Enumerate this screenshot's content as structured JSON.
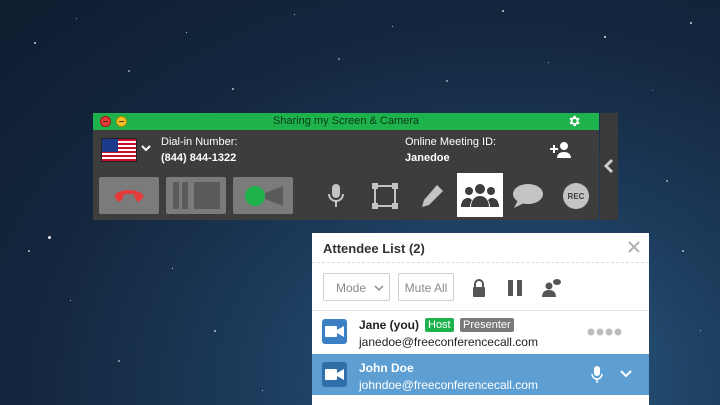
{
  "toolbar": {
    "title": "Sharing my Screen & Camera",
    "dial_in_label": "Dial-in Number:",
    "dial_in_number": "(844) 844-1322",
    "meeting_id_label": "Online Meeting ID:",
    "meeting_id": "Janedoe",
    "country_flag": "us-flag-icon",
    "rec_label": "REC",
    "colors": {
      "titlebar": "#1db24b",
      "bar": "#3d3d3d",
      "hangup": "#e53b3b",
      "camera": "#1db24b"
    }
  },
  "attendees": {
    "title": "Attendee List (2)",
    "mode_label": "Mode",
    "mute_all_label": "Mute All",
    "list": [
      {
        "name": "Jane (you)",
        "email": "janedoe@freeconferencecall.com",
        "tags": [
          "Host",
          "Presenter"
        ]
      },
      {
        "name": "John Doe",
        "email": "johndoe@freeconferencecall.com",
        "tags": []
      }
    ],
    "colors": {
      "selected_row": "#5d9fd2",
      "host_tag": "#1db24b",
      "presenter_tag": "#7a7a7a"
    }
  }
}
